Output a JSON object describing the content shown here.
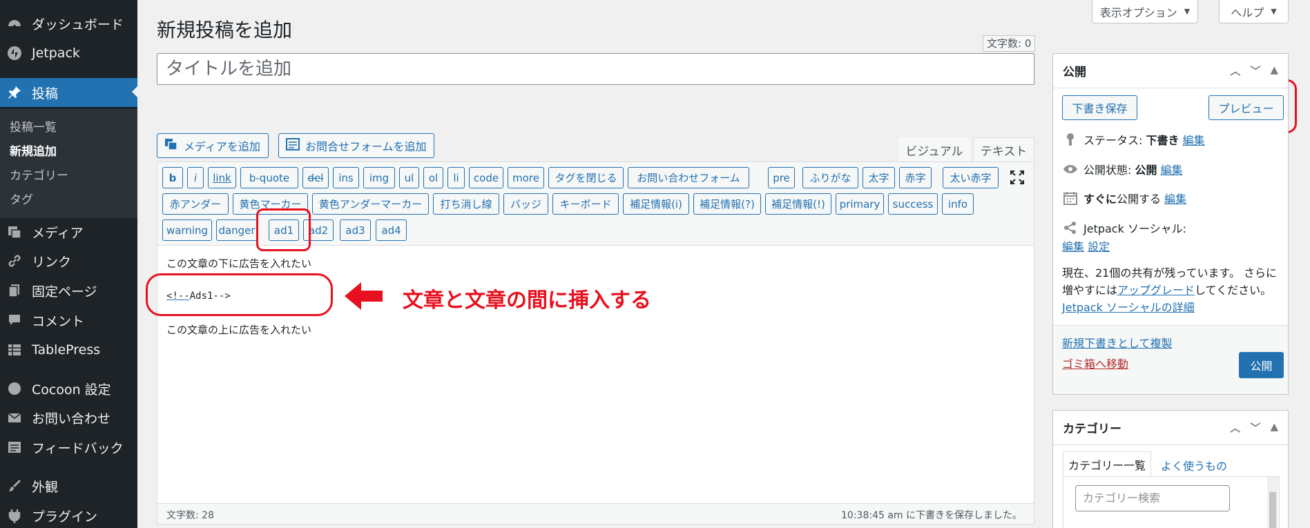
{
  "sidebar": {
    "items": [
      {
        "label": "ダッシュボード",
        "icon": "dashboard-icon"
      },
      {
        "label": "Jetpack",
        "icon": "jetpack-icon"
      },
      {
        "label": "投稿",
        "icon": "pin-icon"
      },
      {
        "label": "メディア",
        "icon": "media-icon"
      },
      {
        "label": "リンク",
        "icon": "link-icon"
      },
      {
        "label": "固定ページ",
        "icon": "page-icon"
      },
      {
        "label": "コメント",
        "icon": "comment-icon"
      },
      {
        "label": "TablePress",
        "icon": "table-icon"
      },
      {
        "label": "Cocoon 設定",
        "icon": "circle-icon"
      },
      {
        "label": "お問い合わせ",
        "icon": "mail-icon"
      },
      {
        "label": "フィードバック",
        "icon": "feedback-icon"
      },
      {
        "label": "外観",
        "icon": "brush-icon"
      },
      {
        "label": "プラグイン",
        "icon": "plugin-icon"
      }
    ],
    "submenu": [
      "投稿一覧",
      "新規追加",
      "カテゴリー",
      "タグ"
    ]
  },
  "header": {
    "title": "新規投稿を追加",
    "screen_options": "表示オプション",
    "help": "ヘルプ"
  },
  "title_field": {
    "placeholder": "タイトルを追加",
    "char_count": "文字数: 0"
  },
  "media_buttons": {
    "add_media": "メディアを追加",
    "add_form": "お問合せフォームを追加"
  },
  "editor_tabs": {
    "visual": "ビジュアル",
    "text": "テキスト"
  },
  "quicktags": {
    "row1": [
      "b",
      "i",
      "link",
      "b-quote",
      "del",
      "ins",
      "img",
      "ul",
      "ol",
      "li",
      "code",
      "more",
      "タグを閉じる",
      "お問い合わせフォーム",
      "pre",
      "ふりがな",
      "太字",
      "赤字",
      "太い赤字"
    ],
    "row2": [
      "赤アンダー",
      "黄色マーカー",
      "黄色アンダーマーカー",
      "打ち消し線",
      "バッジ",
      "キーボード",
      "補足情報(i)",
      "補足情報(?)",
      "補足情報(!)",
      "primary",
      "success",
      "info"
    ],
    "row3": [
      "warning",
      "danger",
      "ad1",
      "ad2",
      "ad3",
      "ad4"
    ]
  },
  "content": {
    "line1": "この文章の下に広告を入れたい",
    "code_part1": "<!--",
    "code_part2": "Ads1-->",
    "line3": "この文章の上に広告を入れたい"
  },
  "status_bar": {
    "word_count": "文字数: 28",
    "saved": "10:38:45 am に下書きを保存しました。"
  },
  "annotation": {
    "text": "文章と文章の間に挿入する",
    "color": "#e8101e"
  },
  "publish": {
    "title": "公開",
    "save_draft": "下書き保存",
    "preview": "プレビュー",
    "status_label": "ステータス: ",
    "status_value": "下書き",
    "visibility_label": "公開状態: ",
    "visibility_value": "公開",
    "schedule_bold": "すぐに",
    "schedule_rest": "公開する",
    "edit": "編集",
    "jetpack_social": "Jetpack ソーシャル:",
    "settings": "設定",
    "shares_text1": "現在、21個の共有が残っています。 さらに",
    "shares_text2": "増やすには",
    "upgrade": "アップグレード",
    "shares_text3": "してください。",
    "jetpack_details": "Jetpack ソーシャルの詳細",
    "duplicate": "新規下書きとして複製",
    "trash": "ゴミ箱へ移動",
    "publish_btn": "公開"
  },
  "categories": {
    "title": "カテゴリー",
    "tab_all": "カテゴリー一覧",
    "tab_popular": "よく使うもの",
    "search_placeholder": "カテゴリー検索"
  },
  "colors": {
    "sidebar_bg": "#1d2327",
    "accent": "#2271b1",
    "annotation": "#e8101e"
  }
}
